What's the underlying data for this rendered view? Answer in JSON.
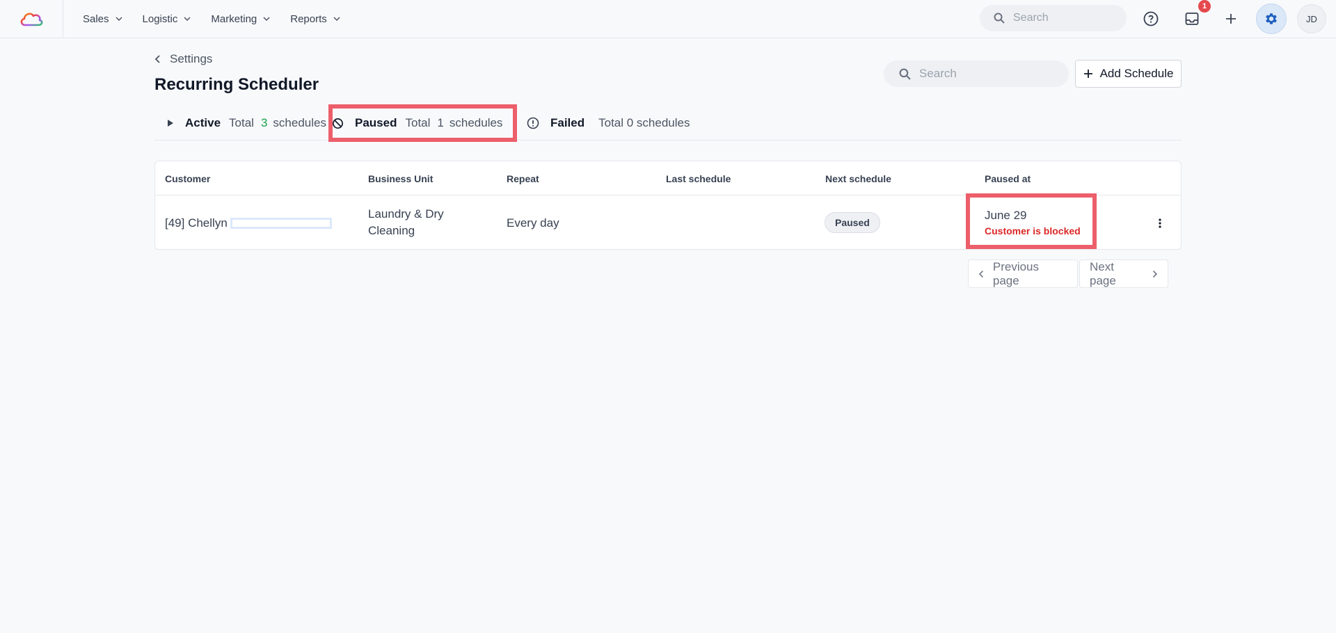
{
  "nav": {
    "items": [
      {
        "label": "Sales"
      },
      {
        "label": "Logistic"
      },
      {
        "label": "Marketing"
      },
      {
        "label": "Reports"
      }
    ],
    "search_placeholder": "Search",
    "notification_count": "1",
    "avatar_initials": "JD"
  },
  "breadcrumb": {
    "label": "Settings"
  },
  "page": {
    "title": "Recurring Scheduler",
    "search_placeholder": "Search",
    "add_label": "Add Schedule"
  },
  "tabs": {
    "active": {
      "name": "Active",
      "total_label": "Total",
      "count": "3",
      "unit": "schedules"
    },
    "paused": {
      "name": "Paused",
      "total_label": "Total",
      "count": "1",
      "unit": "schedules"
    },
    "failed": {
      "name": "Failed",
      "summary": "Total 0 schedules"
    }
  },
  "table": {
    "headers": [
      "Customer",
      "Business Unit",
      "Repeat",
      "Last schedule",
      "Next schedule",
      "Paused at"
    ],
    "rows": [
      {
        "customer": "[49] Chellyn",
        "business_unit_line1": "Laundry & Dry",
        "business_unit_line2": "Cleaning",
        "repeat": "Every day",
        "last_schedule": "",
        "next_schedule": "Paused",
        "paused_at": "June 29",
        "paused_reason": "Customer is blocked"
      }
    ]
  },
  "pagination": {
    "prev": "Previous page",
    "next": "Next page"
  },
  "colors": {
    "highlight": "#ec5f6a",
    "accent_blue": "#1f5fbf",
    "green": "#16a34a",
    "danger": "#dc2626"
  }
}
